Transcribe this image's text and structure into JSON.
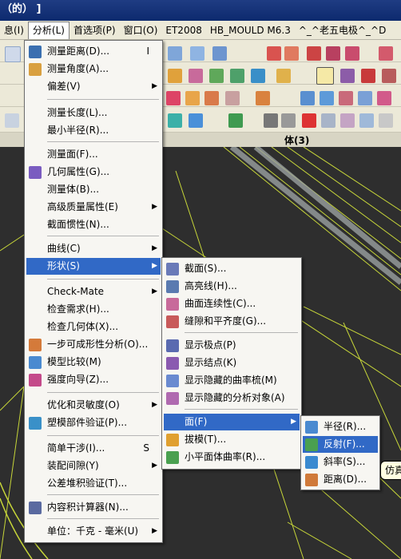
{
  "title": "（的） ]",
  "menubar": [
    "息(I)",
    "分析(L)",
    "首选项(P)",
    "窗口(O)",
    "ET2008",
    "HB_MOULD M6.3",
    "^_^老五电极^_^D"
  ],
  "header_label": "体(3)",
  "analysis_menu": [
    {
      "label": "测量距离(D)...",
      "shortcut": "I",
      "icon": "ruler-icon"
    },
    {
      "label": "测量角度(A)...",
      "icon": "protractor-icon"
    },
    {
      "label": "偏差(V)",
      "submenu": true
    },
    {
      "label": "测量长度(L)..."
    },
    {
      "label": "最小半径(R)..."
    },
    {
      "label": "测量面(F)..."
    },
    {
      "label": "几何属性(G)...",
      "icon": "geometry-props-icon"
    },
    {
      "label": "测量体(B)..."
    },
    {
      "label": "高级质量属性(E)",
      "submenu": true
    },
    {
      "label": "截面惯性(N)..."
    },
    {
      "label": "曲线(C)",
      "submenu": true
    },
    {
      "label": "形状(S)",
      "submenu": true,
      "highlighted": true
    },
    {
      "label": "Check-Mate",
      "submenu": true
    },
    {
      "label": "检查需求(H)..."
    },
    {
      "label": "检查几何体(X)..."
    },
    {
      "label": "一步可成形性分析(O)...",
      "icon": "formability-icon"
    },
    {
      "label": "模型比较(M)",
      "icon": "model-compare-icon"
    },
    {
      "label": "强度向导(Z)...",
      "icon": "strength-wizard-icon"
    },
    {
      "label": "优化和灵敏度(O)",
      "submenu": true
    },
    {
      "label": "塑模部件验证(P)...",
      "icon": "mold-validation-icon"
    },
    {
      "label": "简单干涉(I)...",
      "shortcut": "S"
    },
    {
      "label": "装配间隙(Y)",
      "submenu": true
    },
    {
      "label": "公差堆积验证(T)..."
    },
    {
      "label": "内容积计算器(N)...",
      "icon": "volume-calculator-icon"
    },
    {
      "label": "单位：千克 - 毫米(U)",
      "submenu": true
    }
  ],
  "shape_menu": [
    {
      "label": "截面(S)...",
      "icon": "section-icon"
    },
    {
      "label": "高亮线(H)...",
      "icon": "highlight-lines-icon"
    },
    {
      "label": "曲面连续性(C)...",
      "icon": "surface-continuity-icon"
    },
    {
      "label": "缝隙和平齐度(G)...",
      "icon": "gap-flush-icon"
    },
    {
      "label": "显示极点(P)",
      "icon": "show-poles-icon"
    },
    {
      "label": "显示结点(K)",
      "icon": "show-knots-icon"
    },
    {
      "label": "显示隐藏的曲率梳(M)",
      "icon": "curvature-comb-icon"
    },
    {
      "label": "显示隐藏的分析对象(A)",
      "icon": "analysis-objects-icon"
    },
    {
      "label": "面(F)",
      "submenu": true,
      "highlighted": true
    },
    {
      "label": "拔模(T)...",
      "icon": "draft-icon"
    },
    {
      "label": "小平面体曲率(R)...",
      "icon": "facet-curvature-icon"
    }
  ],
  "face_menu": [
    {
      "label": "半径(R)...",
      "icon": "radius-icon"
    },
    {
      "label": "反射(F)...",
      "icon": "reflection-icon",
      "highlighted": true
    },
    {
      "label": "斜率(S)...",
      "icon": "slope-icon"
    },
    {
      "label": "距离(D)...",
      "icon": "distance-icon"
    }
  ],
  "tooltip": "仿真"
}
